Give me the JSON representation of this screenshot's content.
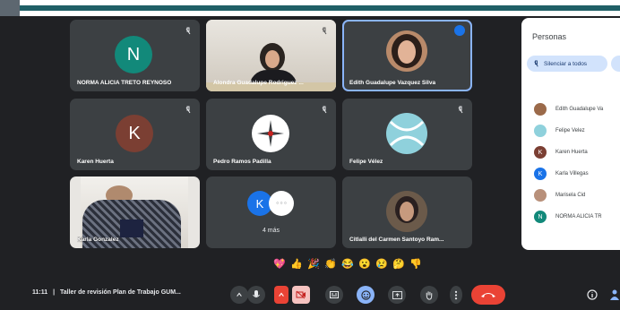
{
  "tiles": [
    {
      "name": "NORMA ALICIA TRETO REYNOSO",
      "initial": "N",
      "avatar_color": "#12897a",
      "muted": true
    },
    {
      "name": "Alondra Guadalupe Rodriguez ...",
      "muted": true
    },
    {
      "name": "Edith Guadalupe Vazquez Silva",
      "speaking": true
    },
    {
      "name": "Karen Huerta",
      "initial": "K",
      "avatar_color": "#7b3f33",
      "muted": true
    },
    {
      "name": "Pedro Ramos Padilla",
      "muted": true
    },
    {
      "name": "Felipe Vélez",
      "muted": true
    },
    {
      "name": "Karla Gonzalez",
      "muted": true
    },
    {
      "name": "4 más",
      "initial": "K"
    },
    {
      "name": "Citlalli del Carmen Santoyo Ram..."
    }
  ],
  "panel": {
    "title": "Personas",
    "mute_all": "Silenciar a todos",
    "people": [
      {
        "name": "Edith Guadalupe Va",
        "color": "#9b6a4a"
      },
      {
        "name": "Felipe Velez",
        "color": "#8fd1dc"
      },
      {
        "name": "Karen Huerta",
        "color": "#7b3f33",
        "initial": "K"
      },
      {
        "name": "Karla Villegas",
        "color": "#1a73e8",
        "initial": "K"
      },
      {
        "name": "Marisela Cid",
        "color": "#b8907a"
      },
      {
        "name": "NORMA ALICIA TR",
        "color": "#12897a",
        "initial": "N"
      }
    ]
  },
  "reactions": [
    "💖",
    "👍",
    "🎉",
    "👏",
    "😂",
    "😮",
    "😢",
    "🤔",
    "👎"
  ],
  "meeting": {
    "time": "11:11",
    "separator": "|",
    "title": "Taller de revisión Plan de Trabajo GUM..."
  },
  "colors": {
    "tile": "#3c4043",
    "background": "#202124",
    "hangup": "#ea4335",
    "accent": "#8ab4f8"
  }
}
